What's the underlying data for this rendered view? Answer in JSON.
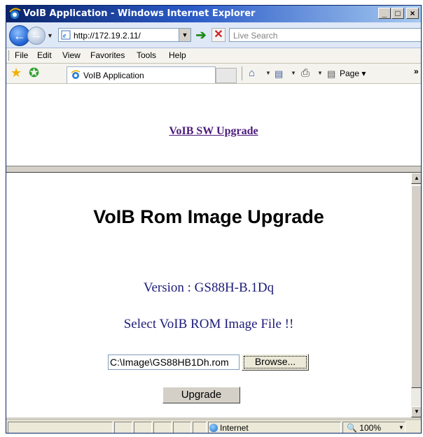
{
  "window": {
    "title": "VoIB Application - Windows Internet Explorer",
    "minimize": "_",
    "maximize": "□",
    "close": "×"
  },
  "addressbar": {
    "url": "http://172.19.2.11/",
    "search_placeholder": "Live Search",
    "go_icon": "go-arrow-icon",
    "stop_icon": "stop-icon"
  },
  "menu": {
    "items": [
      {
        "label": "File"
      },
      {
        "label": "Edit"
      },
      {
        "label": "View"
      },
      {
        "label": "Favorites"
      },
      {
        "label": "Tools"
      },
      {
        "label": "Help"
      }
    ]
  },
  "favbar": {
    "tab_label": "VoIB Application",
    "page_label": "Page ▾",
    "more": "»"
  },
  "top_frame": {
    "link_text": "VoIB SW Upgrade"
  },
  "main": {
    "heading": "VoIB Rom Image Upgrade",
    "version_text": "Version : GS88H-B.1Dq",
    "select_text": "Select VoIB ROM Image File !!",
    "file_value": "C:\\Image\\GS88HB1Dh.rom",
    "browse_label": "Browse...",
    "upgrade_label": "Upgrade"
  },
  "statusbar": {
    "zone": "Internet",
    "zoom": "100%"
  },
  "colors": {
    "title_bar": "#0a246a",
    "link": "#4b1a7a",
    "body_text": "#1c1c7a"
  }
}
